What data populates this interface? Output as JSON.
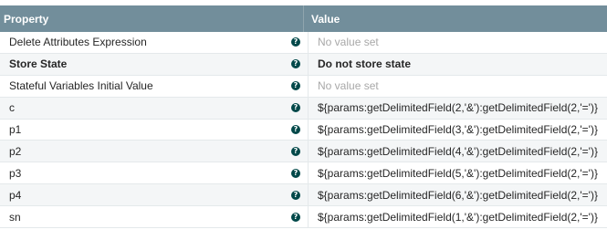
{
  "header": {
    "property": "Property",
    "value": "Value"
  },
  "rows": [
    {
      "name": "Delete Attributes Expression",
      "value": "No value set",
      "bold": false,
      "unset": true
    },
    {
      "name": "Store State",
      "value": "Do not store state",
      "bold": true,
      "unset": false
    },
    {
      "name": "Stateful Variables Initial Value",
      "value": "No value set",
      "bold": false,
      "unset": true
    },
    {
      "name": "c",
      "value": "${params:getDelimitedField(2,'&'):getDelimitedField(2,'=')}",
      "bold": false,
      "unset": false
    },
    {
      "name": "p1",
      "value": "${params:getDelimitedField(3,'&'):getDelimitedField(2,'=')}",
      "bold": false,
      "unset": false
    },
    {
      "name": "p2",
      "value": "${params:getDelimitedField(4,'&'):getDelimitedField(2,'=')}",
      "bold": false,
      "unset": false
    },
    {
      "name": "p3",
      "value": "${params:getDelimitedField(5,'&'):getDelimitedField(2,'=')}",
      "bold": false,
      "unset": false
    },
    {
      "name": "p4",
      "value": "${params:getDelimitedField(6,'&'):getDelimitedField(2,'=')}",
      "bold": false,
      "unset": false
    },
    {
      "name": "sn",
      "value": "${params:getDelimitedField(1,'&'):getDelimitedField(2,'=')}",
      "bold": false,
      "unset": false
    }
  ],
  "icons": {
    "help": "question-circle-icon"
  },
  "colors": {
    "header_bg": "#728e9b",
    "help_icon": "#004849",
    "unset_text": "#a8a8a8"
  }
}
